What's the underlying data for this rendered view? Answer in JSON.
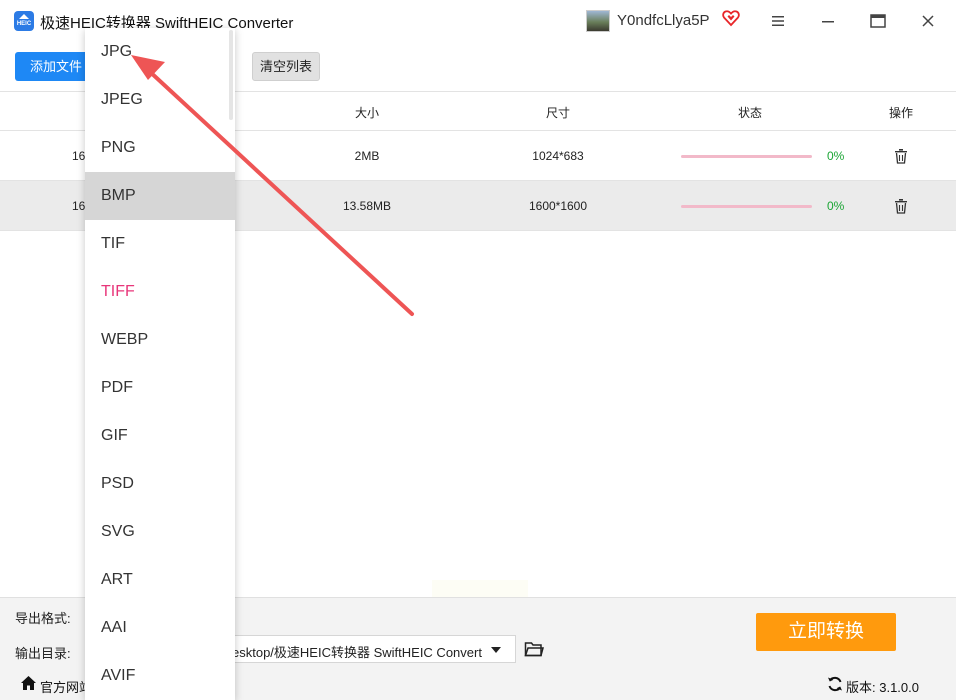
{
  "titlebar": {
    "app_title": "极速HEIC转换器 SwiftHEIC Converter",
    "logo_text": "HEIC",
    "user_name": "Y0ndfcLlya5P"
  },
  "toolbar": {
    "add_label": "添加文件",
    "clear_label": "清空列表"
  },
  "table": {
    "headers": {
      "size": "大小",
      "dimensions": "尺寸",
      "status": "状态",
      "actions": "操作"
    },
    "rows": [
      {
        "name": "16",
        "size": "2MB",
        "dimensions": "1024*683",
        "progress": "0%"
      },
      {
        "name": "16",
        "size": "13.58MB",
        "dimensions": "1600*1600",
        "progress": "0%"
      }
    ]
  },
  "bottom": {
    "format_label": "导出格式:",
    "output_label": "输出目录:",
    "output_path": "esktop/极速HEIC转换器 SwiftHEIC Converter",
    "convert_label": "立即转换",
    "site_link": "官方网站",
    "version": "版本: 3.1.0.0"
  },
  "dropdown": {
    "options": [
      "JPG",
      "JPEG",
      "PNG",
      "BMP",
      "TIF",
      "TIFF",
      "WEBP",
      "PDF",
      "GIF",
      "PSD",
      "SVG",
      "ART",
      "AAI",
      "AVIF"
    ],
    "hovered": "BMP",
    "highlighted": "TIFF"
  },
  "colors": {
    "primary": "#1e88f5",
    "convert": "#ff9a0d",
    "progress_track": "#f2b9c9",
    "percent_text": "#1aa534",
    "highlight_text": "#e8367a",
    "annotation_arrow": "#ee5555"
  },
  "icons": {
    "app_logo": "heic-app-icon",
    "vip": "heart-diamond-icon",
    "menu": "hamburger-icon",
    "minimize": "minimize-icon",
    "maximize": "maximize-icon",
    "close": "close-icon",
    "delete": "trash-icon",
    "folder": "folder-icon",
    "home": "home-icon",
    "refresh": "refresh-icon"
  }
}
